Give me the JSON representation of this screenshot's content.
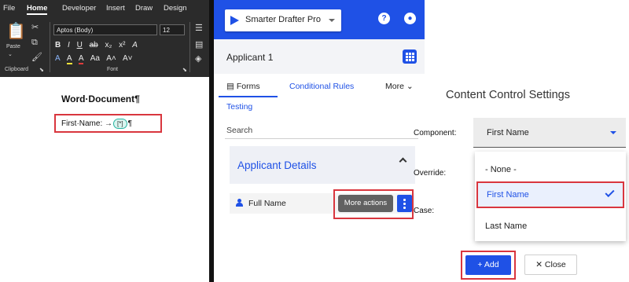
{
  "word": {
    "menu": [
      "File",
      "Home",
      "Developer",
      "Insert",
      "Draw",
      "Design"
    ],
    "active_menu": "Home",
    "ribbon": {
      "paste_label": "Paste",
      "clipboard_label": "Clipboard",
      "font_label": "Font",
      "font_name": "Aptos (Body)",
      "font_size": "12",
      "format_row1": [
        "B",
        "I",
        "U",
        "ab",
        "x₂",
        "x²",
        "A"
      ],
      "format_row2": [
        "A",
        "A",
        "A",
        "Aa",
        "A˄",
        "A˅"
      ]
    },
    "doc_title": "Word·Document¶",
    "field_label": "First·Name: →",
    "content_control": "[*]",
    "pilcrow": "¶"
  },
  "drafter": {
    "product": "Smarter Drafter Pro",
    "applicant_title": "Applicant 1",
    "tabs": [
      "Forms",
      "Conditional Rules",
      "More"
    ],
    "tab_second_row": "Testing",
    "search_placeholder": "Search",
    "section_title": "Applicant Details",
    "field_name": "Full Name",
    "tooltip": "More actions"
  },
  "settings": {
    "title": "Content Control Settings",
    "component_label": "Component:",
    "override_label": "Override:",
    "case_label": "Case:",
    "selected_value": "First Name",
    "options": [
      "- None -",
      "First Name",
      "Last Name"
    ],
    "add_label": "Add",
    "close_label": "Close"
  },
  "colors": {
    "brand_blue": "#1f51e6",
    "highlight_red": "#d9363e",
    "ribbon_dark": "#2b2b2b"
  }
}
